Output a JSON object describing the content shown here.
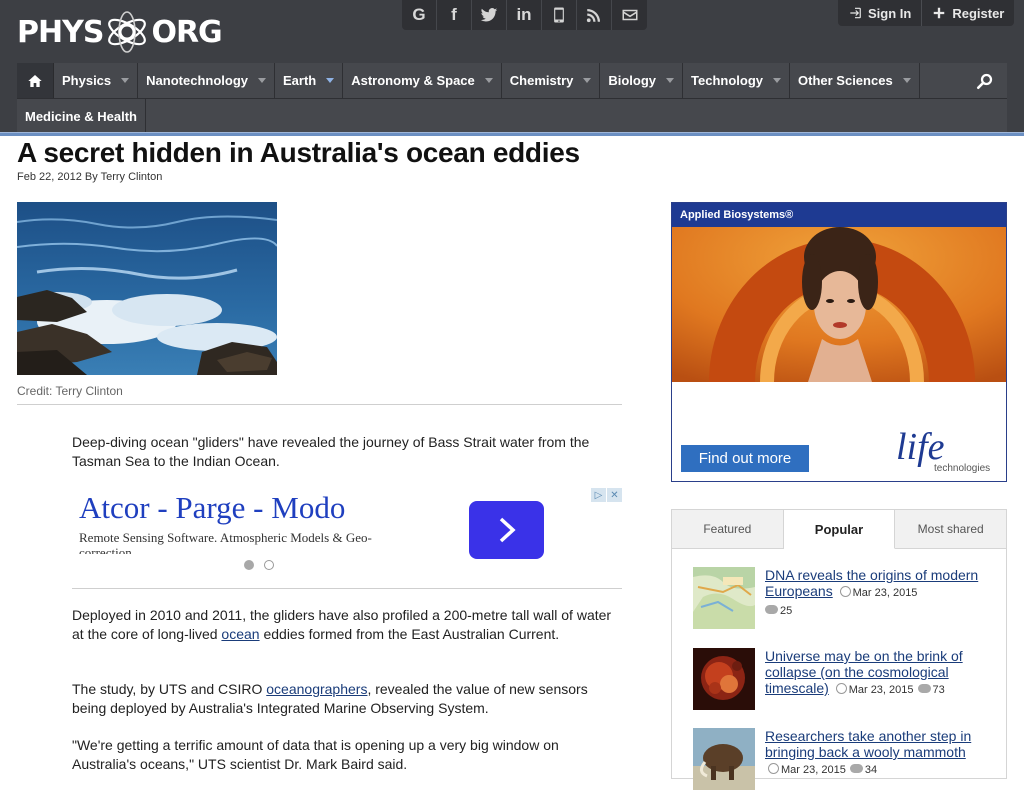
{
  "logo": {
    "left": "PHYS",
    "right": "ORG"
  },
  "social": {
    "items": [
      {
        "name": "google-plus",
        "glyph": "G"
      },
      {
        "name": "facebook",
        "glyph": "f"
      },
      {
        "name": "twitter"
      },
      {
        "name": "linkedin",
        "glyph": "in"
      },
      {
        "name": "mobile"
      },
      {
        "name": "rss"
      },
      {
        "name": "email"
      }
    ]
  },
  "auth": {
    "sign_in": "Sign In",
    "register": "Register"
  },
  "nav": {
    "items": [
      {
        "label": "Physics"
      },
      {
        "label": "Nanotechnology"
      },
      {
        "label": "Earth"
      },
      {
        "label": "Astronomy & Space"
      },
      {
        "label": "Chemistry"
      },
      {
        "label": "Biology"
      },
      {
        "label": "Technology"
      },
      {
        "label": "Other Sciences"
      }
    ],
    "row2": [
      {
        "label": "Medicine & Health"
      }
    ]
  },
  "article": {
    "title": "A secret hidden in Australia's ocean eddies",
    "byline": "Feb 22, 2012 By Terry Clinton",
    "credit": "Credit: Terry Clinton",
    "p1": "Deep-diving ocean \"gliders\" have revealed the journey of Bass Strait water from the Tasman Sea to the Indian Ocean.",
    "p2_before": "Deployed in 2010 and 2011, the gliders have also profiled a 200-metre tall wall of water at the core of long-lived ",
    "p2_link": "ocean",
    "p2_after": " eddies formed from the East Australian Current.",
    "p3_before": "The study, by UTS and CSIRO ",
    "p3_link": "oceanographers",
    "p3_after": ", revealed the value of new sensors being deployed by Australia's Integrated Marine Observing System.",
    "p4": "\"We're getting a terrific amount of data that is opening up a very big window on Australia's oceans,\" UTS scientist Dr. Mark Baird said."
  },
  "inline_ad": {
    "title": "Atcor - Parge - Modo",
    "subtitle": "Remote Sensing Software. Atmospheric Models & Geo-correction"
  },
  "side_ad": {
    "brand": "Applied Biosystems®",
    "cta": "Find out more",
    "logo_word": "life",
    "logo_sub": "technologies"
  },
  "tabs": [
    {
      "label": "Featured",
      "active": false
    },
    {
      "label": "Popular",
      "active": true
    },
    {
      "label": "Most shared",
      "active": false
    }
  ],
  "popular": [
    {
      "title": "DNA reveals the origins of modern Europeans",
      "date": "Mar 23, 2015",
      "comments": "25"
    },
    {
      "title": "Universe may be on the brink of collapse (on the cosmological timescale)",
      "date": "Mar 23, 2015",
      "comments": "73"
    },
    {
      "title": "Researchers take another step in bringing back a wooly mammoth",
      "date": "Mar 23, 2015",
      "comments": "34"
    }
  ],
  "colors": {
    "header_bg": "#3d3f44",
    "nav_bg": "#46484d",
    "accent_line": "#6b8fc2",
    "link": "#1a3c7a",
    "ad_blue": "#1e3a92"
  }
}
